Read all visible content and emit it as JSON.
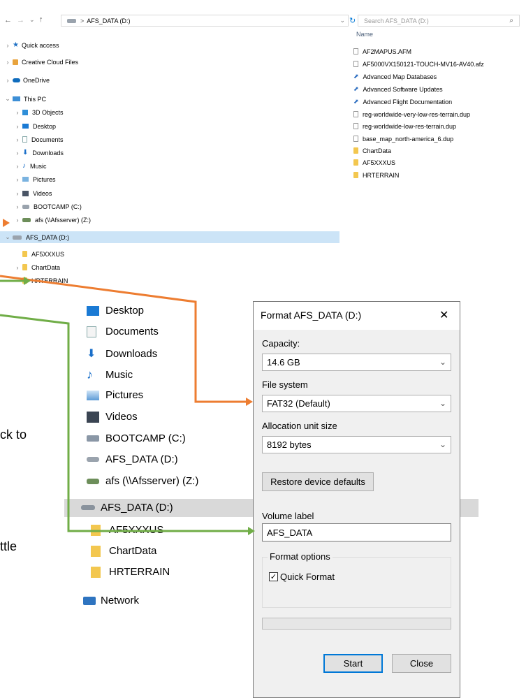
{
  "address_bar": {
    "path_chevron": ">",
    "path_label": "AFS_DATA (D:)",
    "search_placeholder": "Search AFS_DATA (D:)"
  },
  "column_header": "Name",
  "nav_tree": [
    {
      "label": "Quick access",
      "icon": "star-icon"
    },
    {
      "label": "Creative Cloud Files",
      "icon": "creative-cloud-icon"
    },
    {
      "label": "OneDrive",
      "icon": "cloud-icon"
    },
    {
      "label": "This PC",
      "icon": "computer-icon"
    },
    {
      "label": "3D Objects",
      "icon": "cube-icon"
    },
    {
      "label": "Desktop",
      "icon": "desktop-icon"
    },
    {
      "label": "Documents",
      "icon": "documents-icon"
    },
    {
      "label": "Downloads",
      "icon": "download-icon"
    },
    {
      "label": "Music",
      "icon": "music-icon"
    },
    {
      "label": "Pictures",
      "icon": "pictures-icon"
    },
    {
      "label": "Videos",
      "icon": "videos-icon"
    },
    {
      "label": "BOOTCAMP (C:)",
      "icon": "drive-icon"
    },
    {
      "label": "afs (\\\\Afsserver) (Z:)",
      "icon": "network-drive-icon"
    },
    {
      "label": "AFS_DATA (D:)",
      "icon": "drive-icon"
    },
    {
      "label": "AF5XXXUS",
      "icon": "folder-icon"
    },
    {
      "label": "ChartData",
      "icon": "folder-icon"
    },
    {
      "label": "HRTERRAIN",
      "icon": "folder-icon"
    }
  ],
  "files": [
    {
      "name": "AF2MAPUS.AFM",
      "icon": "file-icon"
    },
    {
      "name": "AF5000VX150121-TOUCH-MV16-AV40.afz",
      "icon": "file-icon"
    },
    {
      "name": "Advanced Map Databases",
      "icon": "shortcut-icon"
    },
    {
      "name": "Advanced Software Updates",
      "icon": "shortcut-icon"
    },
    {
      "name": "Advanced Flight Documentation",
      "icon": "shortcut-icon"
    },
    {
      "name": "reg-worldwide-very-low-res-terrain.dup",
      "icon": "file-icon"
    },
    {
      "name": "reg-worldwide-low-res-terrain.dup",
      "icon": "file-icon"
    },
    {
      "name": "base_map_north-america_6.dup",
      "icon": "file-icon"
    },
    {
      "name": "ChartData",
      "icon": "folder-icon"
    },
    {
      "name": "AF5XXXUS",
      "icon": "folder-icon"
    },
    {
      "name": "HRTERRAIN",
      "icon": "folder-icon"
    }
  ],
  "zoomed_tree": [
    {
      "label": "Desktop",
      "icon": "desktop-icon"
    },
    {
      "label": "Documents",
      "icon": "documents-icon"
    },
    {
      "label": "Downloads",
      "icon": "download-icon"
    },
    {
      "label": "Music",
      "icon": "music-icon"
    },
    {
      "label": "Pictures",
      "icon": "pictures-icon"
    },
    {
      "label": "Videos",
      "icon": "videos-icon"
    },
    {
      "label": "BOOTCAMP (C:)",
      "icon": "drive-icon"
    },
    {
      "label": "AFS_DATA (D:)",
      "icon": "drive-icon"
    },
    {
      "label": "afs (\\\\Afsserver) (Z:)",
      "icon": "network-drive-icon"
    },
    {
      "label": "AFS_DATA (D:)",
      "icon": "drive-icon"
    },
    {
      "label": "AF5XXXUS",
      "icon": "folder-icon"
    },
    {
      "label": "ChartData",
      "icon": "folder-icon"
    },
    {
      "label": "HRTERRAIN",
      "icon": "folder-icon"
    },
    {
      "label": "Network",
      "icon": "network-icon"
    }
  ],
  "side_text": {
    "line1": "ck to",
    "line2": "ttle"
  },
  "dialog": {
    "title": "Format AFS_DATA (D:)",
    "close_glyph": "✕",
    "capacity_label": "Capacity:",
    "capacity_value": "14.6 GB",
    "file_system_label": "File system",
    "file_system_value": "FAT32 (Default)",
    "allocation_label": "Allocation unit size",
    "allocation_value": "8192 bytes",
    "restore_button": "Restore device defaults",
    "volume_label_label": "Volume label",
    "volume_label_value": "AFS_DATA",
    "format_options_label": "Format options",
    "quick_format_label": "Quick Format",
    "quick_format_checked": "✓",
    "start_button": "Start",
    "close_button": "Close",
    "dropdown_glyph": "⌄"
  },
  "colors": {
    "orange_arrow": "#ed7d31",
    "green_arrow": "#70ad47",
    "selection": "#cce4f7",
    "accent_blue": "#0078d7"
  }
}
